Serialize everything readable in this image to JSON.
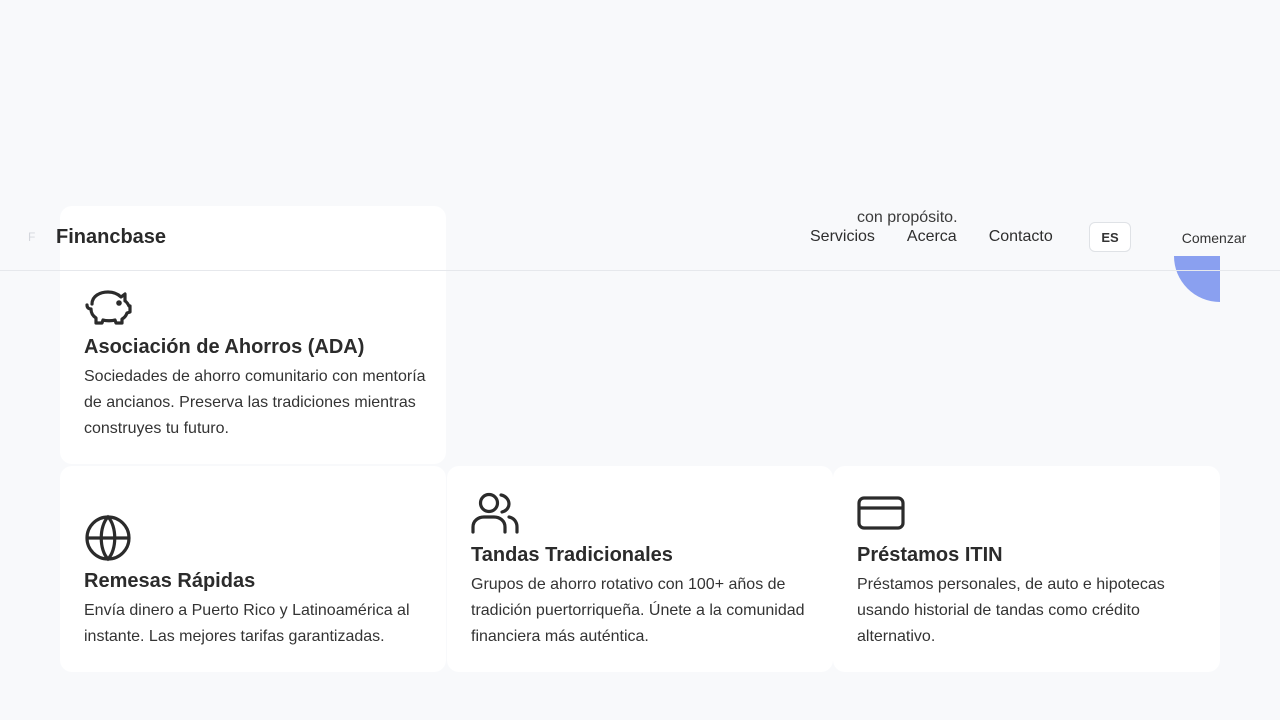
{
  "brand": {
    "ghost_letter": "F",
    "name": "Financbase"
  },
  "nav": {
    "links": [
      "Servicios",
      "Acerca",
      "Contacto"
    ],
    "language": "ES",
    "cta": "Comenzar"
  },
  "hero_fragment": "con propósito.",
  "colors": {
    "accent_blob": "#8aa0f0",
    "background": "#f8f9fb",
    "card": "#ffffff"
  },
  "cards": [
    {
      "icon": "piggy-bank-icon",
      "title": "Asociación de Ahorros (ADA)",
      "description": "Sociedades de ahorro comunitario con mentoría de ancianos. Preserva las tradiciones mientras construyes tu futuro."
    },
    {
      "icon": "globe-icon",
      "title": "Remesas Rápidas",
      "description": "Envía dinero a Puerto Rico y Latinoamérica al instante. Las mejores tarifas garantizadas."
    },
    {
      "icon": "users-icon",
      "title": "Tandas Tradicionales",
      "description": "Grupos de ahorro rotativo con 100+ años de tradición puertorriqueña. Únete a la comunidad financiera más auténtica."
    },
    {
      "icon": "credit-card-icon",
      "title": "Préstamos ITIN",
      "description": "Préstamos personales, de auto e hipotecas usando historial de tandas como crédito alternativo."
    }
  ]
}
